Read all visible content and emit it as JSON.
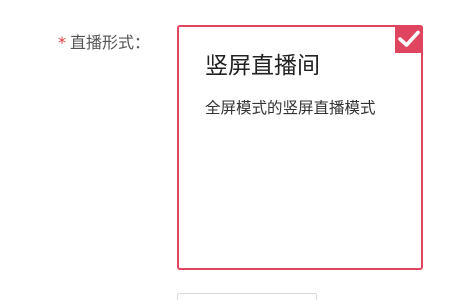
{
  "form": {
    "live_format": {
      "required_mark": "*",
      "label": "直播形式：",
      "option": {
        "title": "竖屏直播间",
        "description": "全屏模式的竖屏直播模式",
        "selected": true,
        "icon": "check-icon"
      }
    }
  },
  "colors": {
    "accent": "#e0455f",
    "required": "#e8383d",
    "label_text": "#555555",
    "title_text": "#222222",
    "desc_text": "#333333",
    "input_border": "#d9d9d9"
  }
}
